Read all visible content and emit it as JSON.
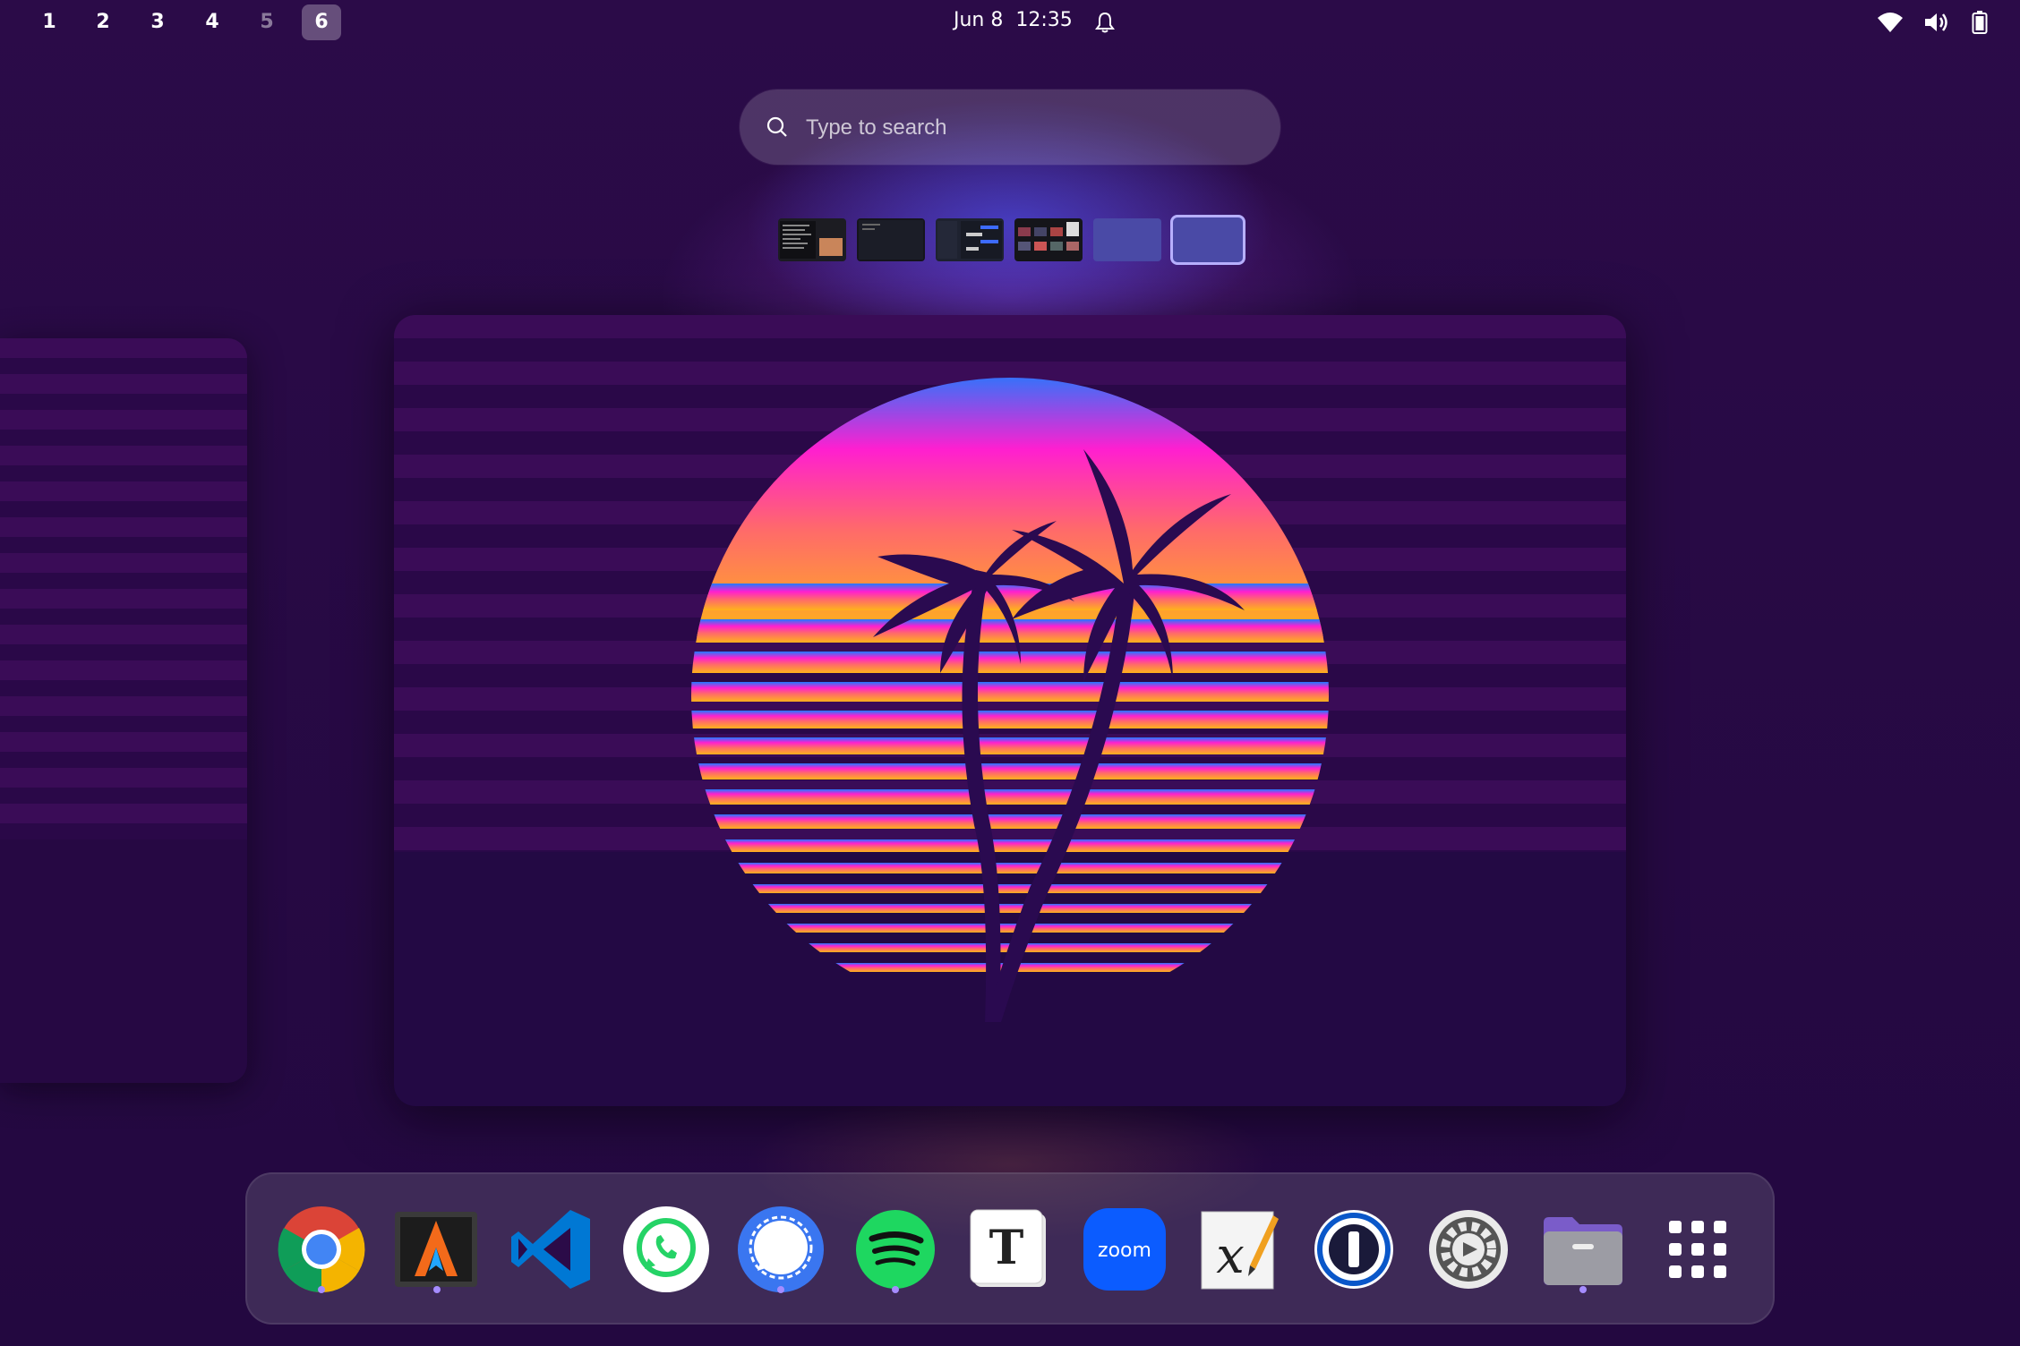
{
  "topbar": {
    "workspaces": [
      {
        "label": "1",
        "state": "normal"
      },
      {
        "label": "2",
        "state": "normal"
      },
      {
        "label": "3",
        "state": "normal"
      },
      {
        "label": "4",
        "state": "normal"
      },
      {
        "label": "5",
        "state": "dim"
      },
      {
        "label": "6",
        "state": "active"
      }
    ],
    "date": "Jun 8",
    "time": "12:35",
    "icons": [
      "bell-icon",
      "wifi-icon",
      "volume-icon",
      "battery-icon"
    ]
  },
  "search": {
    "placeholder": "Type to search",
    "value": ""
  },
  "workspace_thumbnails": [
    {
      "name": "terminal"
    },
    {
      "name": "editor"
    },
    {
      "name": "chat"
    },
    {
      "name": "media-grid"
    },
    {
      "name": "empty"
    },
    {
      "name": "current",
      "selected": true
    }
  ],
  "dock": {
    "apps": [
      {
        "name": "chrome",
        "running": true
      },
      {
        "name": "alacritty",
        "running": true
      },
      {
        "name": "vscode",
        "running": false
      },
      {
        "name": "whatsapp",
        "running": false
      },
      {
        "name": "signal",
        "running": true
      },
      {
        "name": "spotify",
        "running": true
      },
      {
        "name": "typora",
        "running": false
      },
      {
        "name": "zoom",
        "running": false
      },
      {
        "name": "xournal",
        "running": false
      },
      {
        "name": "1password",
        "running": false
      },
      {
        "name": "settings",
        "running": false
      },
      {
        "name": "files",
        "running": true
      },
      {
        "name": "show-apps",
        "running": false
      }
    ],
    "zoom_label": "zoom",
    "typora_letter": "T",
    "xournal_letter": "x"
  },
  "colors": {
    "accent": "#a58cff",
    "sun_top": "#1f7bff",
    "sun_mid": "#ff1fd0",
    "sun_bottom": "#ffb31a",
    "palm": "#2a0a50"
  }
}
